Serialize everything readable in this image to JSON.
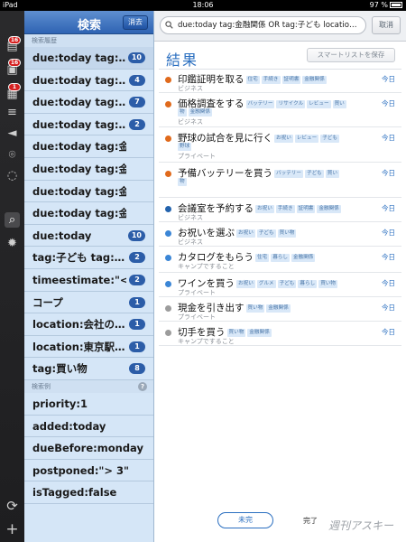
{
  "status_bar": {
    "device": "iPad",
    "time": "18:06",
    "battery": "97 %"
  },
  "rail": {
    "badges": [
      "16",
      "16",
      "1"
    ],
    "icons": [
      "inbox-icon",
      "today-icon",
      "calendar-icon",
      "list-icon",
      "tag-icon",
      "location-icon",
      "search-icon",
      "settings-icon",
      "sync-icon",
      "add-icon"
    ]
  },
  "left_panel": {
    "title": "検索",
    "clear_label": "消去",
    "history_label": "検索履歴",
    "examples_label": "検索例",
    "help_label": "?",
    "history": [
      {
        "text": "due:today tag:…",
        "count": "10"
      },
      {
        "text": "due:today tag:…",
        "count": "4"
      },
      {
        "text": "due:today tag:…",
        "count": "7"
      },
      {
        "text": "due:today tag:…",
        "count": "2"
      },
      {
        "text": "due:today tag:金融関…",
        "count": ""
      },
      {
        "text": "due:today tag:金融関…",
        "count": ""
      },
      {
        "text": "due:today tag:金融関…",
        "count": ""
      },
      {
        "text": "due:today tag:金融関…",
        "count": ""
      },
      {
        "text": "due:today",
        "count": "10"
      },
      {
        "text": "tag:子ども tag:…",
        "count": "2"
      },
      {
        "text": "timeestimate:\"<…",
        "count": "2"
      },
      {
        "text": "コープ",
        "count": "1"
      },
      {
        "text": "location:会社の…",
        "count": "1"
      },
      {
        "text": "location:東京駅…",
        "count": "1"
      },
      {
        "text": "tag:買い物",
        "count": "8"
      }
    ],
    "examples": [
      "priority:1",
      "added:today",
      "dueBefore:monday",
      "postponed:\"> 3\"",
      "isTagged:false"
    ]
  },
  "search": {
    "query": "due:today tag:金融関係 OR tag:子ども locatio…",
    "cancel_label": "取消"
  },
  "results": {
    "title": "結果",
    "save_label": "スマートリストを保存",
    "tasks": [
      {
        "title": "印鑑証明を取る",
        "tags": [
          "住宅",
          "手続き",
          "証明書",
          "金融関係"
        ],
        "tags2": [],
        "list": "ビジネス",
        "due": "今日",
        "color": "#e06a1c"
      },
      {
        "title": "価格調査をする",
        "tags": [
          "バッテリー",
          "リサイクル",
          "レビュー",
          "買い"
        ],
        "tags2": [
          "物",
          "金融関係"
        ],
        "list": "ビジネス",
        "due": "今日",
        "color": "#e06a1c"
      },
      {
        "title": "野球の試合を見に行く",
        "tags": [
          "お祝い",
          "レビュー",
          "子ども"
        ],
        "tags2": [
          "野球"
        ],
        "list": "プライベート",
        "due": "今日",
        "color": "#e06a1c"
      },
      {
        "title": "予備バッテリーを買う",
        "tags": [
          "バッテリー",
          "子ども",
          "買い"
        ],
        "tags2": [
          "物"
        ],
        "list": "",
        "due": "今日",
        "color": "#e06a1c"
      },
      {
        "title": "会議室を予約する",
        "tags": [
          "お祝い",
          "手続き",
          "証明書",
          "金融関係"
        ],
        "tags2": [],
        "list": "ビジネス",
        "due": "今日",
        "color": "#2363ad"
      },
      {
        "title": "お祝いを選ぶ",
        "tags": [
          "お祝い",
          "子ども",
          "買い物"
        ],
        "tags2": [],
        "list": "ビジネス",
        "due": "今日",
        "color": "#3b86d6"
      },
      {
        "title": "カタログをもらう",
        "tags": [
          "住宅",
          "暮らし",
          "金融関係"
        ],
        "tags2": [],
        "list": "キャンプですること",
        "due": "今日",
        "color": "#3b86d6"
      },
      {
        "title": "ワインを買う",
        "tags": [
          "お祝い",
          "グルメ",
          "子ども",
          "暮らし",
          "買い物"
        ],
        "tags2": [],
        "list": "プライベート",
        "due": "今日",
        "color": "#3b86d6"
      },
      {
        "title": "現金を引き出す",
        "tags": [
          "買い物",
          "金融関係"
        ],
        "tags2": [],
        "list": "プライベート",
        "due": "今日",
        "color": "#9c9c9c"
      },
      {
        "title": "切手を買う",
        "tags": [
          "買い物",
          "金融関係"
        ],
        "tags2": [],
        "list": "キャンプですること",
        "due": "今日",
        "color": "#9c9c9c"
      }
    ]
  },
  "bottom": {
    "incomplete_label": "未完",
    "complete_label": "完了",
    "watermark": "週刊アスキー"
  }
}
